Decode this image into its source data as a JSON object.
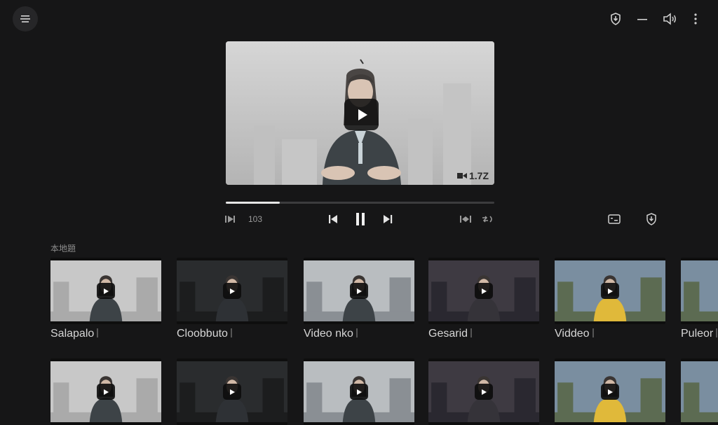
{
  "player": {
    "duration_badge": "1.7Z",
    "time_label": "103",
    "progress": 0.2
  },
  "shelf": {
    "title": "本地題"
  },
  "cards_row1": [
    {
      "title": "Salapalo",
      "badge": ""
    },
    {
      "title": "Cloobbuto",
      "badge": ""
    },
    {
      "title": "Video nko",
      "badge": ""
    },
    {
      "title": "Gesarid",
      "badge": ""
    },
    {
      "title": "Viddeo",
      "badge": ""
    },
    {
      "title": "Puleor",
      "badge": ""
    }
  ],
  "icons": {
    "menu": "hamburger-icon",
    "shield": "shield-icon",
    "minimize": "minimize-icon",
    "volume": "volume-icon",
    "more": "more-vert-icon"
  },
  "colors": {
    "background": "#161617",
    "accent": "#e6e6e6"
  }
}
